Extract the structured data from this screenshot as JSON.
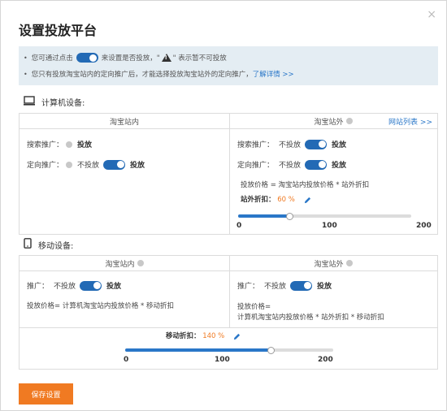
{
  "dialog": {
    "title": "设置投放平台",
    "close": "×"
  },
  "notice": {
    "line1_pre": "您可通过点击",
    "line1_mid": "来设置是否投放，\"",
    "line1_post": "\" 表示暂不可投放",
    "line2_pre": "您只有投放淘宝站内的定向推广后，才能选择投放淘宝站外的定向推广，",
    "line2_link": "了解详情 >>"
  },
  "computer": {
    "section_label": "计算机设备:",
    "inner_header": "淘宝站内",
    "outer_header": "淘宝站外",
    "site_list_link": "网站列表 >>",
    "inner": {
      "search_label": "搜索推广：",
      "search_status": "投放",
      "target_label": "定向推广：",
      "target_off": "不投放",
      "target_on": "投放"
    },
    "outer": {
      "search_label": "搜索推广：",
      "search_off": "不投放",
      "search_on": "投放",
      "target_label": "定向推广：",
      "target_off": "不投放",
      "target_on": "投放",
      "formula": "投放价格 = 淘宝站内投放价格 * 站外折扣",
      "discount_label": "站外折扣：",
      "discount_value": "60 %",
      "slider": {
        "min_label": "0",
        "mid_label": "100",
        "max_label": "200",
        "value": 60,
        "max": 200
      }
    }
  },
  "mobile": {
    "section_label": "移动设备:",
    "inner_header": "淘宝站内",
    "outer_header": "淘宝站外",
    "inner": {
      "promo_label": "推广：",
      "promo_off": "不投放",
      "promo_on": "投放",
      "formula": "投放价格= 计算机淘宝站内投放价格 * 移动折扣"
    },
    "outer": {
      "promo_label": "推广：",
      "promo_off": "不投放",
      "promo_on": "投放",
      "formula_line1": "投放价格=",
      "formula_line2": "计算机淘宝站内投放价格 * 站外折扣 * 移动折扣"
    },
    "discount_label": "移动折扣：",
    "discount_value": "140 %",
    "slider": {
      "min_label": "0",
      "mid_label": "100",
      "max_label": "200",
      "value": 140,
      "max": 200
    }
  },
  "save_button": "保存设置",
  "colors": {
    "accent": "#2a77c8",
    "toggle": "#236ab5",
    "orange": "#f07a22",
    "notice_bg": "#e4edf3"
  },
  "icons": {
    "toggle": "toggle-switch-icon",
    "warning": "warning-triangle-icon",
    "monitor": "monitor-icon",
    "phone": "phone-icon",
    "help": "question-circle-icon",
    "edit": "pencil-icon"
  }
}
